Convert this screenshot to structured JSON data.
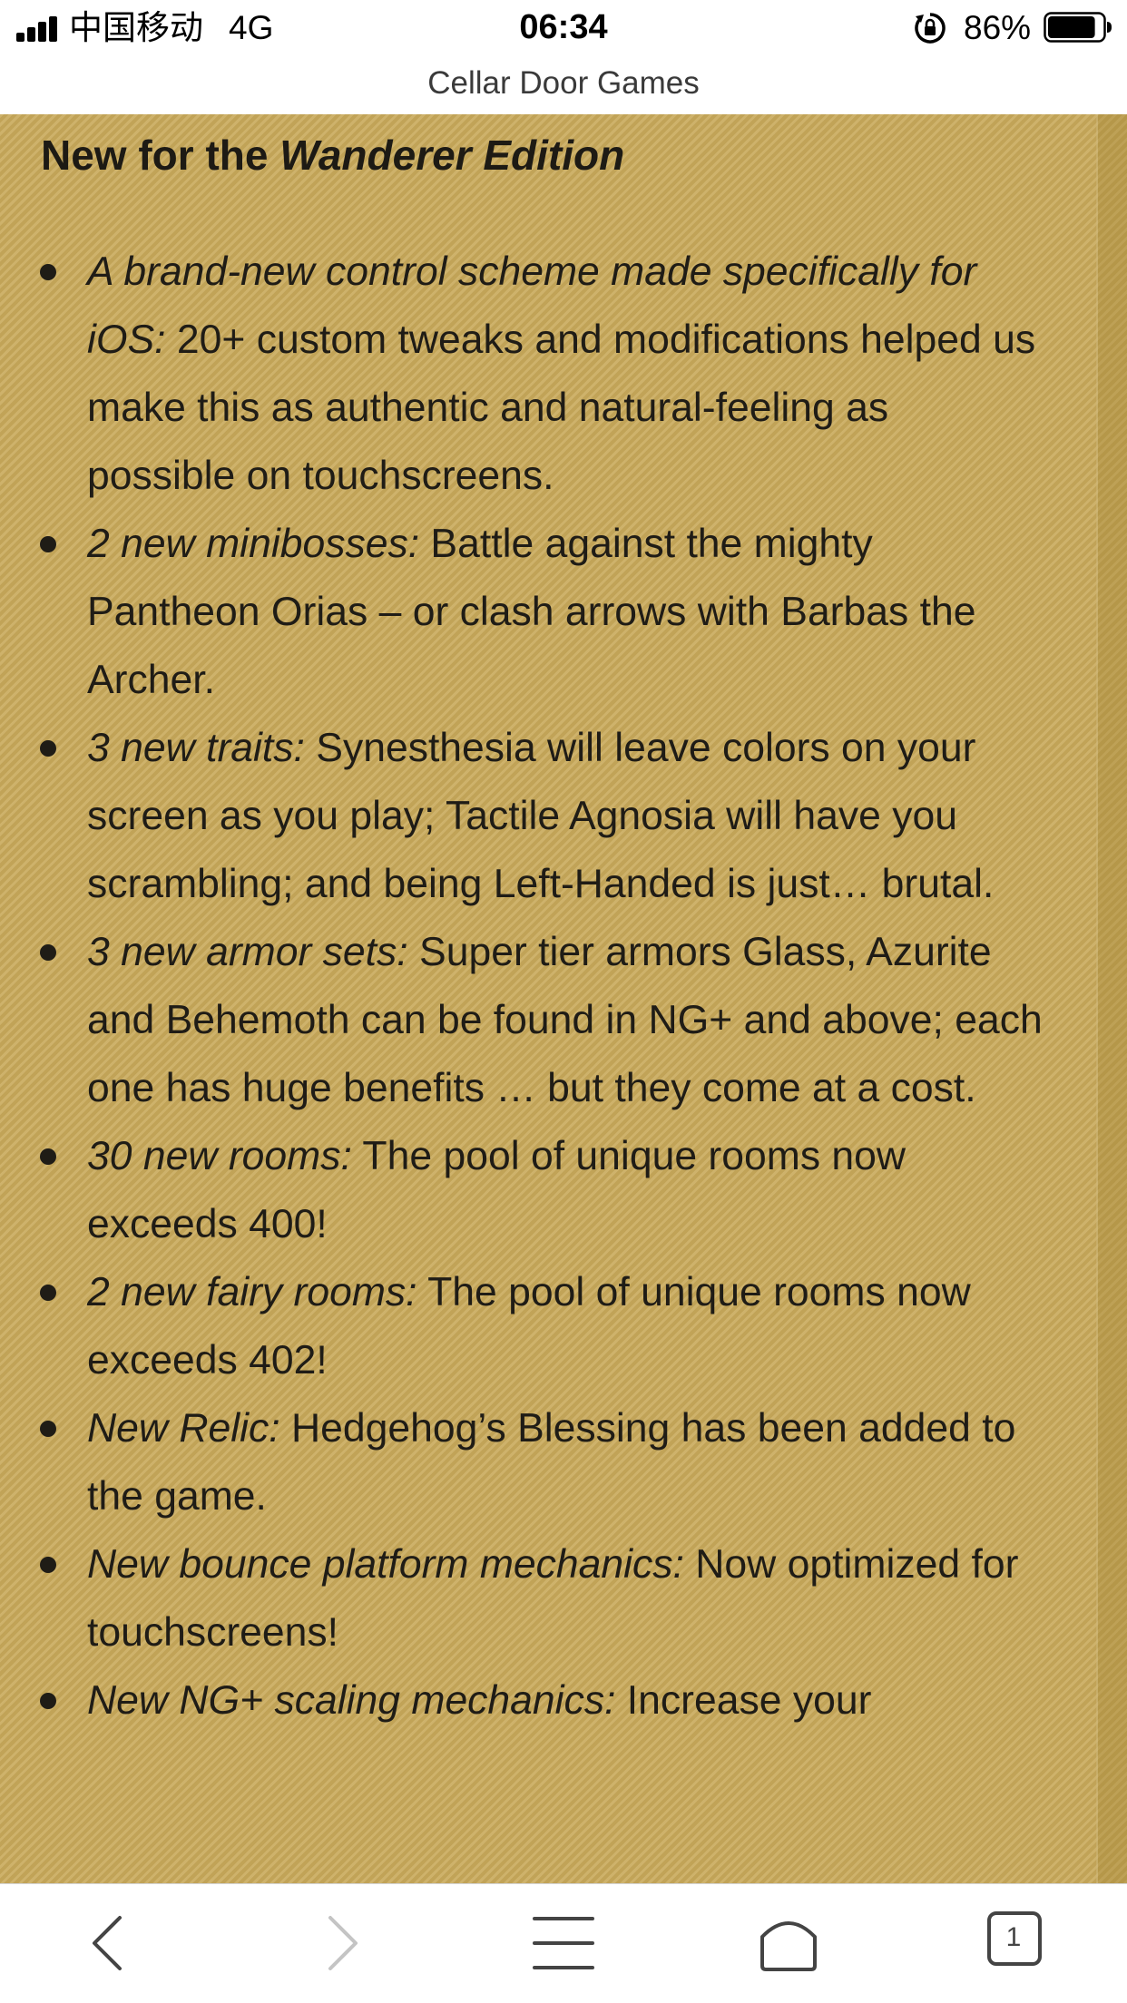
{
  "status_bar": {
    "carrier": "中国移动",
    "network": "4G",
    "time": "06:34",
    "battery_percent": "86%",
    "battery_level": 0.86
  },
  "address_bar": {
    "title": "Cellar Door Games"
  },
  "content": {
    "heading_prefix": "New for the ",
    "heading_emphasis": "Wanderer Edition",
    "features": [
      {
        "lead": "A brand-new control scheme made specifically for iOS:",
        "text": " 20+ custom tweaks and modifications helped us make this as authentic and natural-feeling as possible on touchscreens."
      },
      {
        "lead": "2 new minibosses:",
        "text": " Battle against the mighty Pantheon Orias – or clash arrows with Barbas the Archer."
      },
      {
        "lead": "3 new traits:",
        "text": " Synesthesia will leave colors on your screen as you play; Tactile Agnosia will have you scrambling; and being Left-Handed is just… brutal."
      },
      {
        "lead": "3 new armor sets:",
        "text": " Super tier armors Glass, Azurite and Behemoth can be found in NG+ and above; each one has huge benefits … but they come at a cost."
      },
      {
        "lead": "30 new rooms:",
        "text": " The pool of unique rooms now exceeds 400!"
      },
      {
        "lead": "2 new fairy rooms:",
        "text": " The pool of unique rooms now exceeds 402!"
      },
      {
        "lead": "New Relic:",
        "text": " Hedgehog’s Blessing has been added to the game."
      },
      {
        "lead": "New bounce platform mechanics:",
        "text": " Now optimized for touchscreens!"
      },
      {
        "lead": "New NG+ scaling mechanics:",
        "text": " Increase your"
      }
    ]
  },
  "toolbar": {
    "tab_count": "1",
    "icons": [
      "back-arrow-icon",
      "forward-arrow-icon",
      "menu-icon",
      "home-icon",
      "tabs-icon"
    ]
  },
  "colors": {
    "page_background": "#c8a95a",
    "text": "#1f1c16"
  }
}
